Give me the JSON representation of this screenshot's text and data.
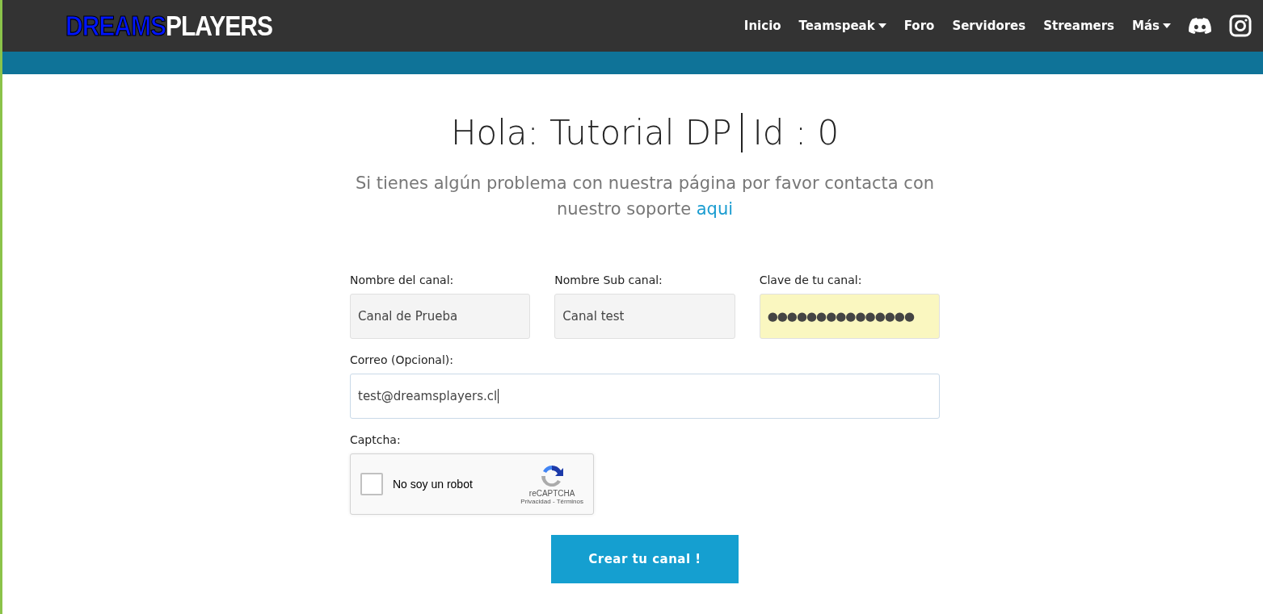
{
  "logo": {
    "part_1": "DREAMS",
    "part_2": "PLAYERS"
  },
  "nav": [
    {
      "label": "Inicio",
      "dropdown": false
    },
    {
      "label": "Teamspeak",
      "dropdown": true
    },
    {
      "label": "Foro",
      "dropdown": false
    },
    {
      "label": "Servidores",
      "dropdown": false
    },
    {
      "label": "Streamers",
      "dropdown": false
    },
    {
      "label": "Más",
      "dropdown": true
    }
  ],
  "social": [
    {
      "kind": "discord"
    },
    {
      "kind": "instagram"
    }
  ],
  "heading": {
    "greeting": "Hola: Tutorial DP",
    "id": "Id : 0"
  },
  "intro": {
    "text": "Si tienes algún problema con nuestra página por favor contacta con nuestro soporte",
    "link": "aqui"
  },
  "fields": [
    {
      "label": "Nombre del canal:",
      "value": "Canal de Prueba",
      "kind": "readonly"
    },
    {
      "label": "Nombre Sub canal:",
      "value": "Canal test",
      "kind": "readonly"
    },
    {
      "label": "Clave de tu canal:",
      "value": "●●●●●●●●●●●●●●●",
      "kind": "autofilled"
    }
  ],
  "email": {
    "label": "Correo (Opcional):",
    "value": "test@dreamsplayers.cl",
    "focused": true
  },
  "captcha": {
    "label": "Captcha:",
    "checkbox_label": "No soy un robot",
    "checked": false,
    "brand": "reCAPTCHA",
    "privacy": "Privacidad",
    "separator": "-",
    "terms": "Términos"
  },
  "submit": "Crear tu canal !"
}
